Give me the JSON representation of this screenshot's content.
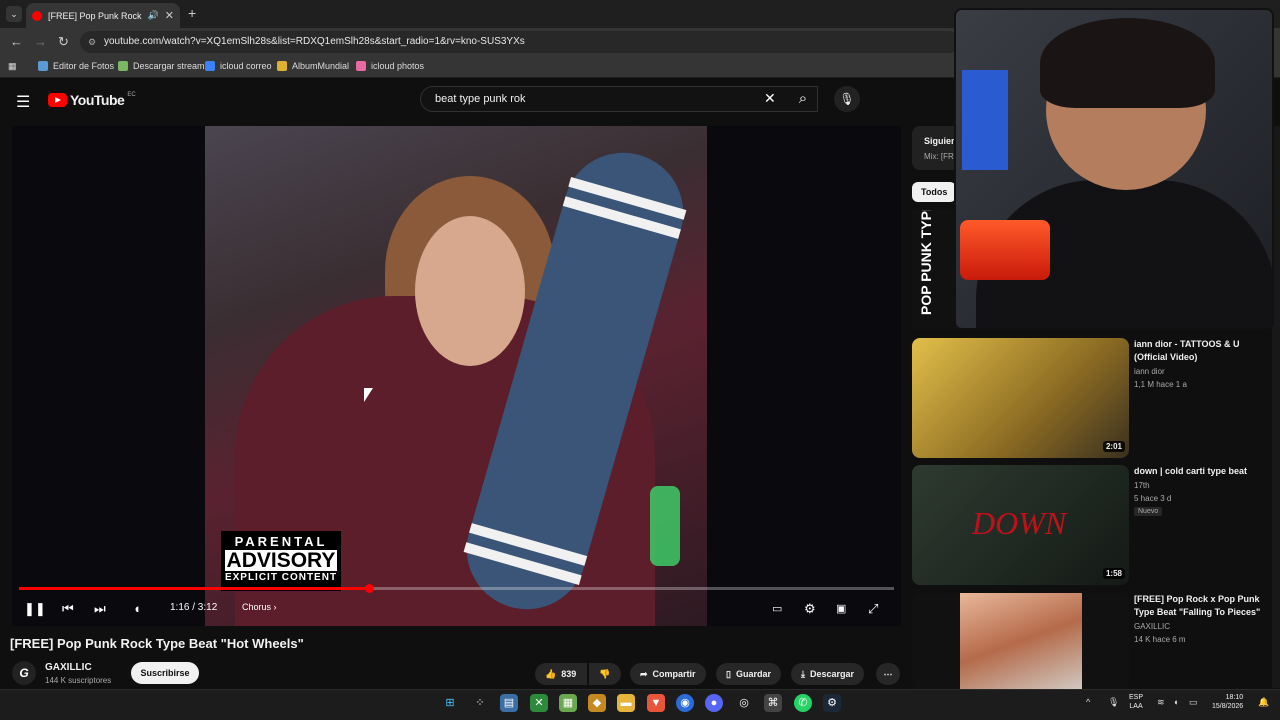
{
  "browser": {
    "tab_title": "[FREE] Pop Punk Rock Type",
    "url": "youtube.com/watch?v=XQ1emSlh28s&list=RDXQ1emSlh28s&start_radio=1&rv=kno-SUS3YXs",
    "bookmarks": [
      {
        "label": "Editor de Fotos",
        "icon": "photo-editor-icon",
        "color": "#5b9bd5"
      },
      {
        "label": "Descargar stream",
        "icon": "download-stream-icon",
        "color": "#7bb661"
      },
      {
        "label": "icloud correo",
        "icon": "icloud-mail-icon",
        "color": "#3b82f6"
      },
      {
        "label": "AlbumMundial",
        "icon": "album-icon",
        "color": "#e0b030"
      },
      {
        "label": "icloud photos",
        "icon": "icloud-photos-icon",
        "color": "#e86aa0"
      }
    ]
  },
  "youtube": {
    "logo_text": "YouTube",
    "country_code": "EC",
    "search_value": "beat type punk rok"
  },
  "player": {
    "time": "1:16 / 3:12",
    "chapter": "Chorus",
    "progress_fraction": 0.4,
    "advisory_line1": "PARENTAL",
    "advisory_line2": "ADVISORY",
    "advisory_line3": "EXPLICIT CONTENT"
  },
  "video": {
    "title": "[FREE] Pop Punk Rock Type Beat \"Hot Wheels\"",
    "channel": "GAXILLIC",
    "channel_initial": "G",
    "subscribers": "144 K suscriptores",
    "subscribe_label": "Suscribirse",
    "likes": "839",
    "share_label": "Compartir",
    "save_label": "Guardar",
    "download_label": "Descargar"
  },
  "sidebar": {
    "playlist_next": "Siguiente",
    "playlist_mix": "Mix: [FREE]",
    "chip_all": "Todos",
    "first_thumb_text": "POP PUNK TYPE BEAT",
    "recommendations": [
      {
        "title": "iann dior - TATTOOS & U (Official Video)",
        "channel": "iann dior",
        "meta": "1,1 M  hace 1 a",
        "duration": "2:01",
        "badge": "",
        "color": "#c9a23a"
      },
      {
        "title": "down | cold carti type beat",
        "channel": "17th",
        "meta": "5  hace 3 d",
        "duration": "1:58",
        "badge": "Nuevo",
        "color": "#1f2a22"
      },
      {
        "title": "[FREE] Pop Rock x Pop Punk Type Beat \"Falling To Pieces\"",
        "channel": "GAXILLIC",
        "meta": "14 K  hace 6 m",
        "duration": "",
        "badge": "",
        "color": "#c07a5a"
      }
    ]
  },
  "taskbar": {
    "lang_line1": "ESP",
    "lang_line2": "LAA",
    "time": "18:10",
    "date": "15/8/2026"
  }
}
